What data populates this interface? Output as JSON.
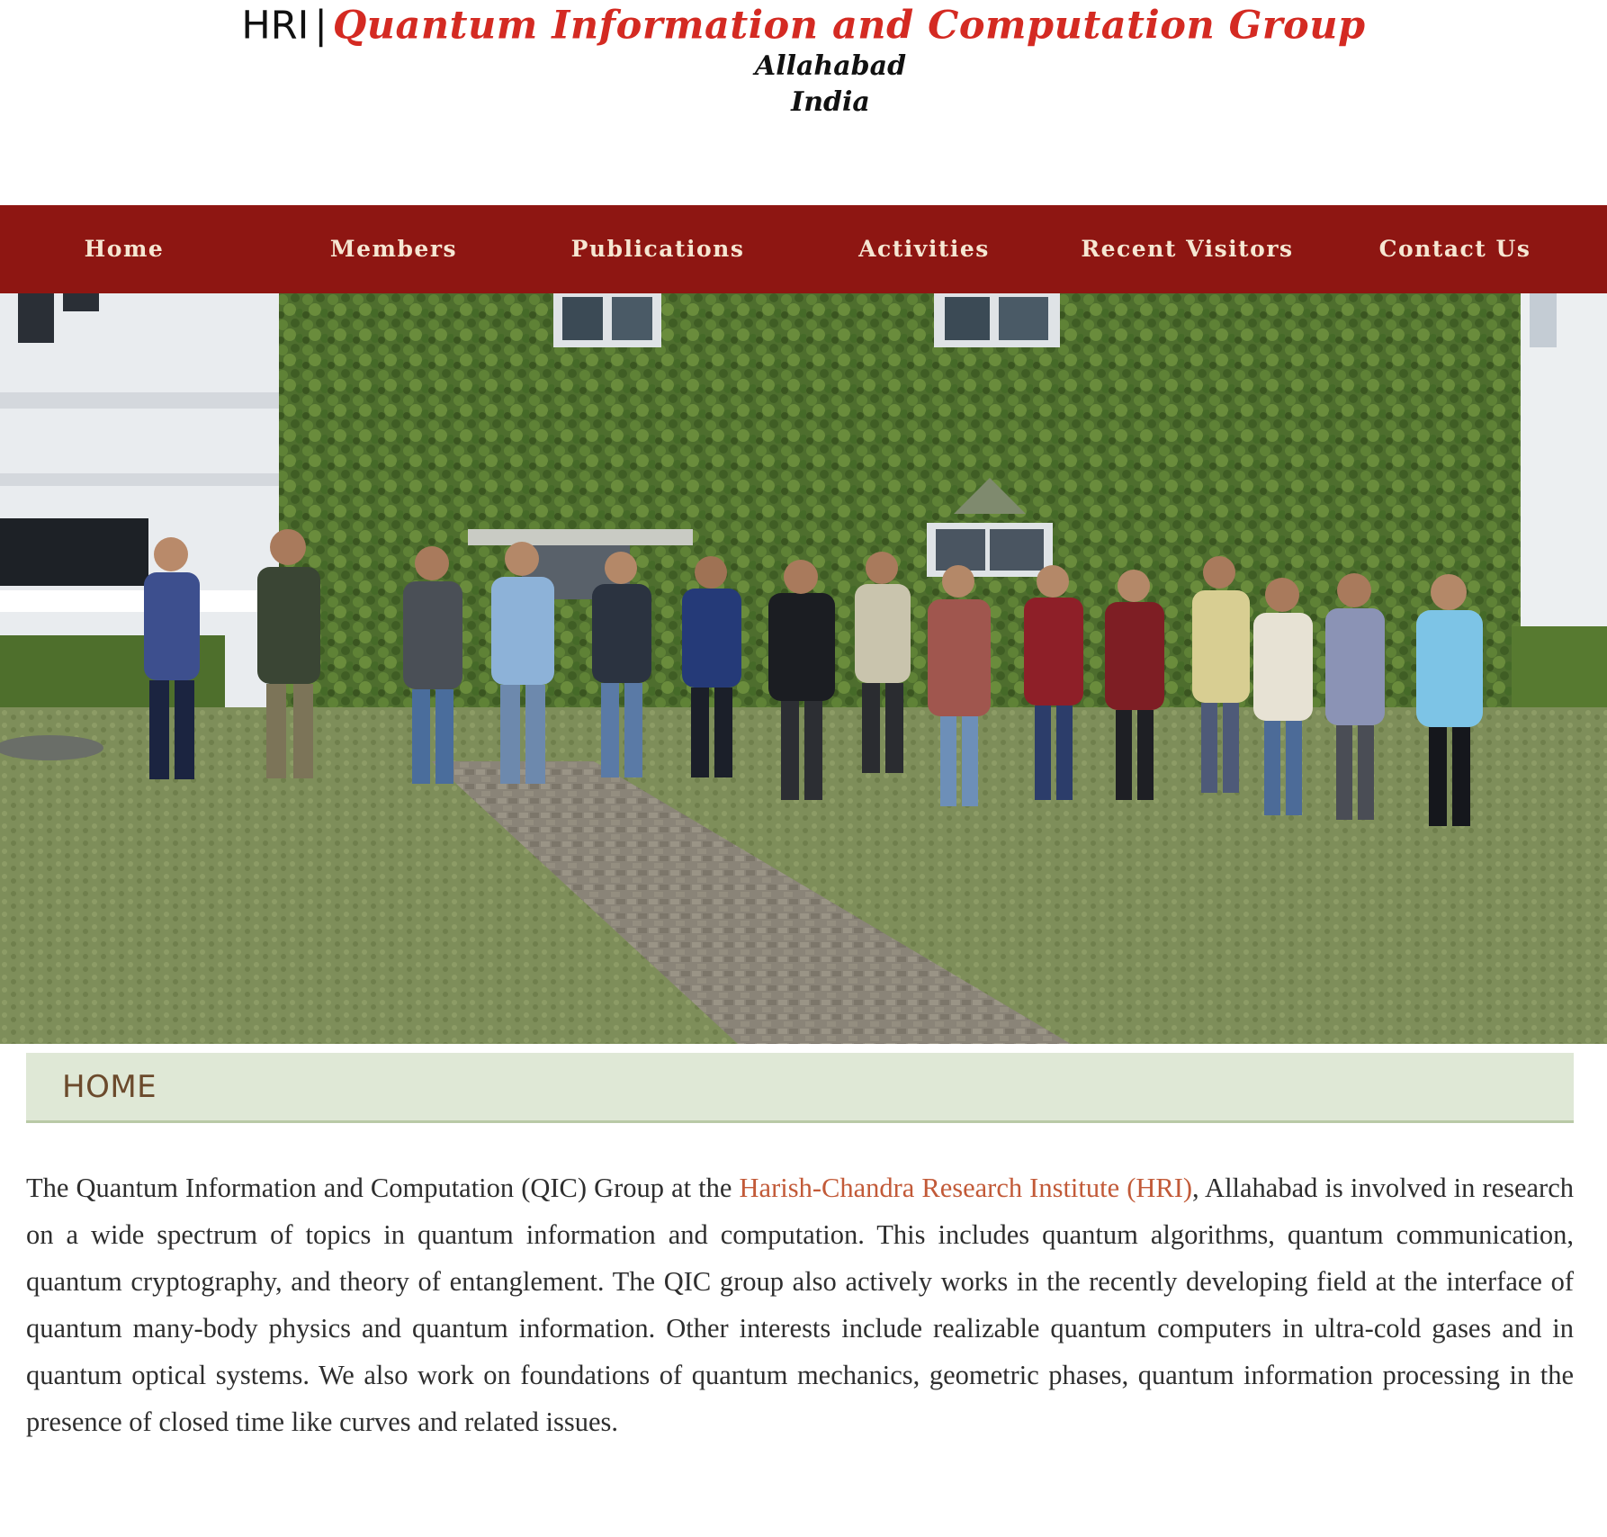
{
  "header": {
    "prefix": "HRI",
    "separator": "|",
    "group_name": "Quantum Information and Computation Group",
    "city": "Allahabad",
    "country": "India"
  },
  "nav": {
    "items": [
      {
        "label": "Home"
      },
      {
        "label": "Members"
      },
      {
        "label": "Publications"
      },
      {
        "label": "Activities"
      },
      {
        "label": "Recent Visitors"
      },
      {
        "label": "Contact Us"
      }
    ]
  },
  "colors": {
    "nav_background": "#8e1612",
    "nav_text": "#f6e6d2",
    "title_red": "#d42a22",
    "heading_background": "#dfe8d6",
    "heading_text": "#6b4a2c",
    "link": "#c25a38"
  },
  "hero": {
    "image": "group-photo"
  },
  "section": {
    "title": "HOME"
  },
  "intro": {
    "before_link": "The Quantum Information and Computation (QIC) Group at the ",
    "link_text": "Harish-Chandra Research Institute (HRI)",
    "after_link": ", Allahabad is involved in research on a wide spectrum of topics in quantum information and computation. This includes quantum algorithms, quantum communication, quantum cryptography, and theory of entanglement. The QIC group also actively works in the recently developing field at the interface of quantum many-body physics and quantum information. Other interests include realizable quantum computers in ultra-cold gases and in quantum optical systems. We also work on foundations of quantum mechanics, geometric phases, quantum information processing in the presence of closed time like curves and related issues."
  }
}
